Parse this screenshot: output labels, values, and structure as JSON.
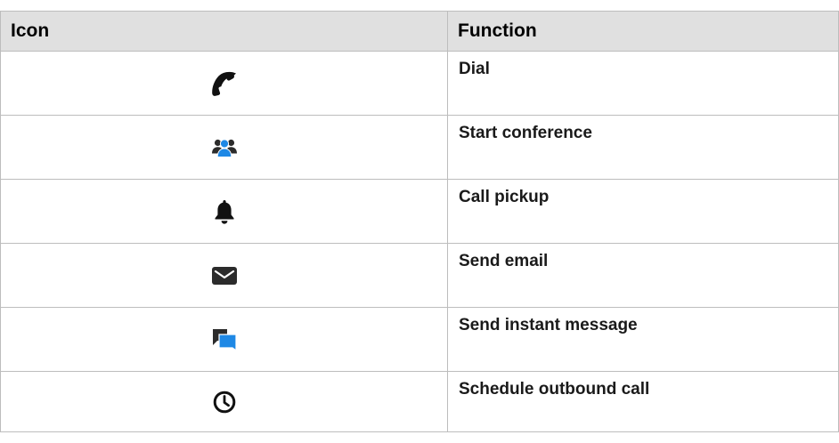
{
  "table": {
    "headers": {
      "icon": "Icon",
      "function": "Function"
    },
    "rows": [
      {
        "icon": "phone-handset-icon",
        "function": "Dial"
      },
      {
        "icon": "conference-people-icon",
        "function": "Start conference"
      },
      {
        "icon": "bell-icon",
        "function": "Call pickup"
      },
      {
        "icon": "envelope-icon",
        "function": "Send email"
      },
      {
        "icon": "chat-bubbles-icon",
        "function": "Send instant message"
      },
      {
        "icon": "clock-icon",
        "function": "Schedule outbound call"
      }
    ]
  },
  "colors": {
    "header_background": "#e0e0e0",
    "border": "#bdbdbd",
    "icon_dark": "#111111",
    "icon_accent": "#1e88e5",
    "icon_muted": "#2b2b2b"
  }
}
